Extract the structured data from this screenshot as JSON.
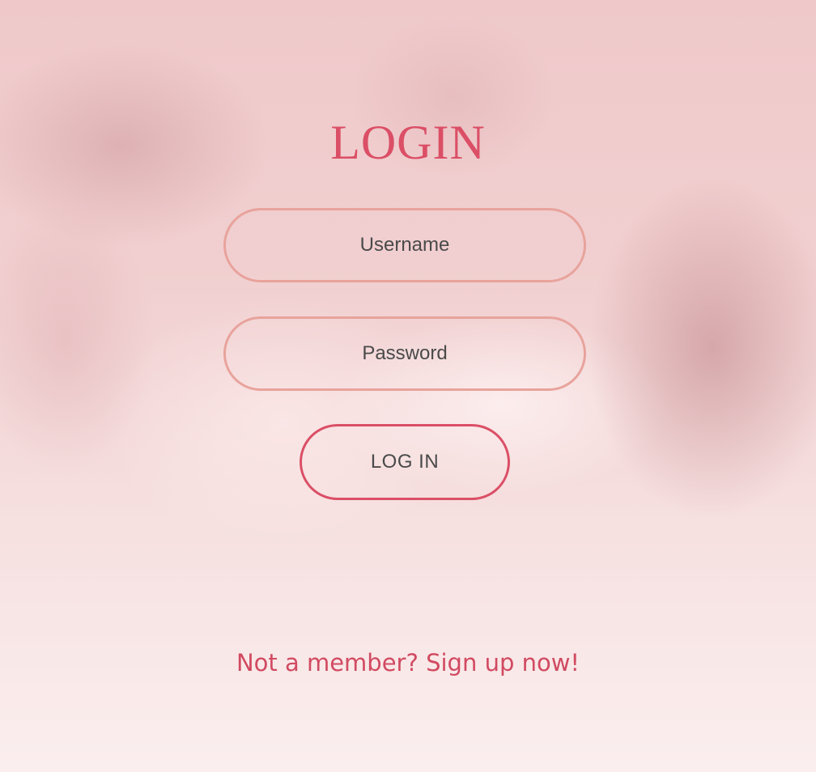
{
  "colors": {
    "accent": "#db4f66",
    "field_border": "#e8a39c",
    "text": "#4a4a4a",
    "background": "#f3d3d3"
  },
  "login": {
    "title": "LOGIN",
    "username_placeholder": "Username",
    "password_placeholder": "Password",
    "submit_label": "LOG IN",
    "signup_link": "Not a member? Sign up now!"
  }
}
